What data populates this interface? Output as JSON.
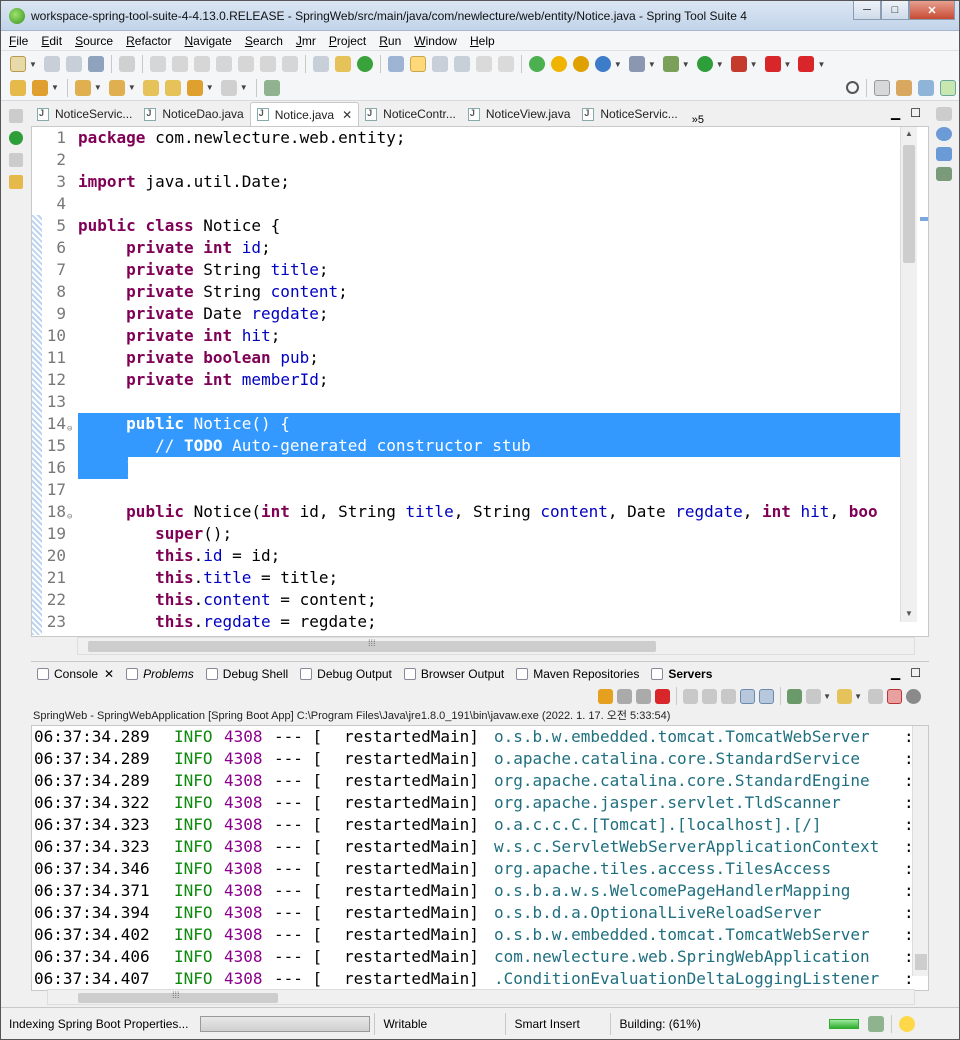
{
  "window": {
    "title": "workspace-spring-tool-suite-4-4.13.0.RELEASE - SpringWeb/src/main/java/com/newlecture/web/entity/Notice.java - Spring Tool Suite 4",
    "min": "─",
    "max": "□",
    "close": "✕"
  },
  "menu": [
    "File",
    "Edit",
    "Source",
    "Refactor",
    "Navigate",
    "Search",
    "Jmr",
    "Project",
    "Run",
    "Window",
    "Help"
  ],
  "tabs": [
    {
      "label": "NoticeServic...",
      "active": false
    },
    {
      "label": "NoticeDao.java",
      "active": false
    },
    {
      "label": "Notice.java",
      "active": true
    },
    {
      "label": "NoticeContr...",
      "active": false
    },
    {
      "label": "NoticeView.java",
      "active": false
    },
    {
      "label": "NoticeServic...",
      "active": false
    }
  ],
  "tabs_more": "»5",
  "editor": {
    "lines": [
      {
        "n": "1",
        "html": "<span class='kw'>package</span> com.newlecture.web.entity;"
      },
      {
        "n": "2",
        "html": ""
      },
      {
        "n": "3",
        "html": "<span class='kw'>import</span> java.util.Date;"
      },
      {
        "n": "4",
        "html": ""
      },
      {
        "n": "5",
        "html": "<span class='kw'>public</span> <span class='kw'>class</span> Notice {"
      },
      {
        "n": "6",
        "html": "     <span class='kw'>private</span> <span class='kw'>int</span> <span class='fld'>id</span>;"
      },
      {
        "n": "7",
        "html": "     <span class='kw'>private</span> String <span class='fld'>title</span>;"
      },
      {
        "n": "8",
        "html": "     <span class='kw'>private</span> String <span class='fld'>content</span>;"
      },
      {
        "n": "9",
        "html": "     <span class='kw'>private</span> Date <span class='fld'>regdate</span>;"
      },
      {
        "n": "10",
        "html": "     <span class='kw'>private</span> <span class='kw'>int</span> <span class='fld'>hit</span>;"
      },
      {
        "n": "11",
        "html": "     <span class='kw'>private</span> <span class='kw'>boolean</span> <span class='fld'>pub</span>;"
      },
      {
        "n": "12",
        "html": "     <span class='kw'>private</span> <span class='kw'>int</span> <span class='fld'>memberId</span>;"
      },
      {
        "n": "13",
        "html": ""
      },
      {
        "n": "14",
        "fold": "⊖",
        "html": "<span class='onsel'>     <b>public</b> Notice() {</span>"
      },
      {
        "n": "15",
        "html": "<span class='onsel'>        // <b>TODO</b> Auto-generated constructor stub</span>"
      },
      {
        "n": "16",
        "html": "<span class='onsel'>     }</span>"
      },
      {
        "n": "17",
        "html": ""
      },
      {
        "n": "18",
        "fold": "⊖",
        "html": "     <span class='kw'>public</span> Notice(<span class='kw'>int</span> id, String <span class='fld'>title</span>, String <span class='fld'>content</span>, Date <span class='fld'>regdate</span>, <span class='kw'>int</span> <span class='fld'>hit</span>, <span class='kw'>boo</span>"
      },
      {
        "n": "19",
        "html": "        <span class='kw'>super</span>();"
      },
      {
        "n": "20",
        "html": "        <span class='kw'>this</span>.<span class='fld'>id</span> = id;"
      },
      {
        "n": "21",
        "html": "        <span class='kw'>this</span>.<span class='fld'>title</span> = title;"
      },
      {
        "n": "22",
        "html": "        <span class='kw'>this</span>.<span class='fld'>content</span> = content;"
      },
      {
        "n": "23",
        "html": "        <span class='kw'>this</span>.<span class='fld'>regdate</span> = regdate;"
      }
    ]
  },
  "console_tabs": [
    {
      "label": "Console",
      "active": true,
      "style": ""
    },
    {
      "label": "Problems",
      "active": false,
      "style": "italic"
    },
    {
      "label": "Debug Shell",
      "active": false,
      "style": ""
    },
    {
      "label": "Debug Output",
      "active": false,
      "style": ""
    },
    {
      "label": "Browser Output",
      "active": false,
      "style": ""
    },
    {
      "label": "Maven Repositories",
      "active": false,
      "style": ""
    },
    {
      "label": "Servers",
      "active": false,
      "style": "bold"
    }
  ],
  "console": {
    "header": "SpringWeb - SpringWebApplication [Spring Boot App] C:\\Program Files\\Java\\jre1.8.0_191\\bin\\javaw.exe  (2022. 1. 17. 오전 5:33:54)",
    "rows": [
      {
        "ts": "06:37:34.289",
        "lv": "INFO",
        "pid": "4308",
        "sep": "--- [",
        "th": "restartedMain]",
        "lg": "o.s.b.w.embedded.tomcat.TomcatWebServer",
        "c": ":"
      },
      {
        "ts": "06:37:34.289",
        "lv": "INFO",
        "pid": "4308",
        "sep": "--- [",
        "th": "restartedMain]",
        "lg": "o.apache.catalina.core.StandardService",
        "c": ":"
      },
      {
        "ts": "06:37:34.289",
        "lv": "INFO",
        "pid": "4308",
        "sep": "--- [",
        "th": "restartedMain]",
        "lg": "org.apache.catalina.core.StandardEngine",
        "c": ":"
      },
      {
        "ts": "06:37:34.322",
        "lv": "INFO",
        "pid": "4308",
        "sep": "--- [",
        "th": "restartedMain]",
        "lg": "org.apache.jasper.servlet.TldScanner",
        "c": ":"
      },
      {
        "ts": "06:37:34.323",
        "lv": "INFO",
        "pid": "4308",
        "sep": "--- [",
        "th": "restartedMain]",
        "lg": "o.a.c.c.C.[Tomcat].[localhost].[/]",
        "c": ":"
      },
      {
        "ts": "06:37:34.323",
        "lv": "INFO",
        "pid": "4308",
        "sep": "--- [",
        "th": "restartedMain]",
        "lg": "w.s.c.ServletWebServerApplicationContext",
        "c": ":"
      },
      {
        "ts": "06:37:34.346",
        "lv": "INFO",
        "pid": "4308",
        "sep": "--- [",
        "th": "restartedMain]",
        "lg": "org.apache.tiles.access.TilesAccess",
        "c": ":"
      },
      {
        "ts": "06:37:34.371",
        "lv": "INFO",
        "pid": "4308",
        "sep": "--- [",
        "th": "restartedMain]",
        "lg": "o.s.b.a.w.s.WelcomePageHandlerMapping",
        "c": ":"
      },
      {
        "ts": "06:37:34.394",
        "lv": "INFO",
        "pid": "4308",
        "sep": "--- [",
        "th": "restartedMain]",
        "lg": "o.s.b.d.a.OptionalLiveReloadServer",
        "c": ":"
      },
      {
        "ts": "06:37:34.402",
        "lv": "INFO",
        "pid": "4308",
        "sep": "--- [",
        "th": "restartedMain]",
        "lg": "o.s.b.w.embedded.tomcat.TomcatWebServer",
        "c": ":"
      },
      {
        "ts": "06:37:34.406",
        "lv": "INFO",
        "pid": "4308",
        "sep": "--- [",
        "th": "restartedMain]",
        "lg": "com.newlecture.web.SpringWebApplication",
        "c": ":"
      },
      {
        "ts": "06:37:34.407",
        "lv": "INFO",
        "pid": "4308",
        "sep": "--- [",
        "th": "restartedMain]",
        "lg": ".ConditionEvaluationDeltaLoggingListener",
        "c": ":"
      }
    ]
  },
  "status": {
    "indexing": "Indexing Spring Boot Properties...",
    "writable": "Writable",
    "insert": "Smart Insert",
    "building": "Building: (61%)",
    "building_progress": 61
  },
  "colors": {
    "selection": "#3399ff",
    "keyword": "#7f0055",
    "field": "#0000c0",
    "info": "#0b8a0b",
    "pid": "#8b008b",
    "logger": "#1f6f7f"
  }
}
